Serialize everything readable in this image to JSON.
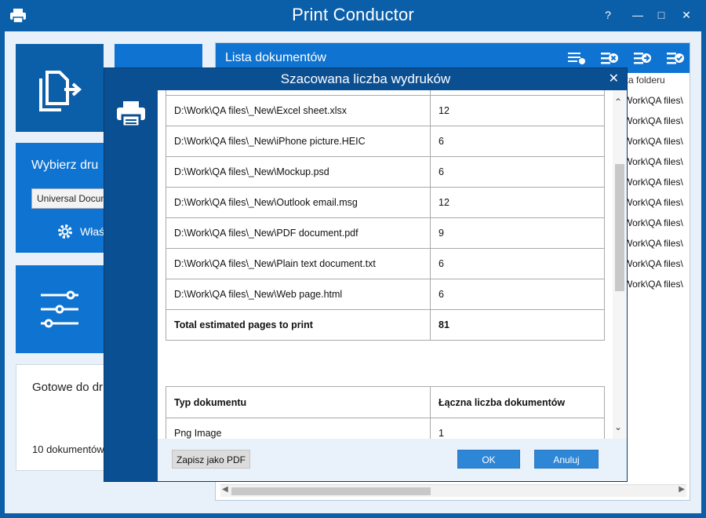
{
  "app": {
    "title": "Print Conductor"
  },
  "window_controls": {
    "help": "?",
    "minimize": "—",
    "maximize": "□",
    "close": "✕"
  },
  "left": {
    "printer_label": "Wybierz dru",
    "printer_select": "Universal Docum",
    "properties_label": "Właś",
    "status_title": "Gotowe do dr",
    "status_count": "10 dokumentów"
  },
  "list": {
    "title": "Lista dokumentów",
    "column_header": "ka folderu",
    "rows": [
      "Work\\QA files\\",
      "Work\\QA files\\",
      "Work\\QA files\\",
      "Work\\QA files\\",
      "Work\\QA files\\",
      "Work\\QA files\\",
      "Work\\QA files\\",
      "Work\\QA files\\",
      "Work\\QA files\\",
      "Work\\QA files\\"
    ]
  },
  "dialog": {
    "title": "Szacowana liczba wydruków",
    "close": "✕",
    "pages_rows": [
      {
        "file": "D:\\Work\\QA files\\_New\\Excel sheet.xlsx",
        "pages": "12"
      },
      {
        "file": "D:\\Work\\QA files\\_New\\iPhone picture.HEIC",
        "pages": "6"
      },
      {
        "file": "D:\\Work\\QA files\\_New\\Mockup.psd",
        "pages": "6"
      },
      {
        "file": "D:\\Work\\QA files\\_New\\Outlook email.msg",
        "pages": "12"
      },
      {
        "file": "D:\\Work\\QA files\\_New\\PDF document.pdf",
        "pages": "9"
      },
      {
        "file": "D:\\Work\\QA files\\_New\\Plain text document.txt",
        "pages": "6"
      },
      {
        "file": "D:\\Work\\QA files\\_New\\Web page.html",
        "pages": "6"
      }
    ],
    "total": {
      "label": "Total estimated pages to print",
      "value": "81"
    },
    "types_header": {
      "type": "Typ dokumentu",
      "count": "Łączna liczba dokumentów"
    },
    "types_rows": [
      {
        "type": "Png Image",
        "count": "1"
      }
    ],
    "save_pdf": "Zapisz jako PDF",
    "ok": "OK",
    "cancel": "Anuluj"
  },
  "colors": {
    "brand": "#0b5ea8",
    "tile": "#0f73d1",
    "button": "#2e86d6"
  }
}
